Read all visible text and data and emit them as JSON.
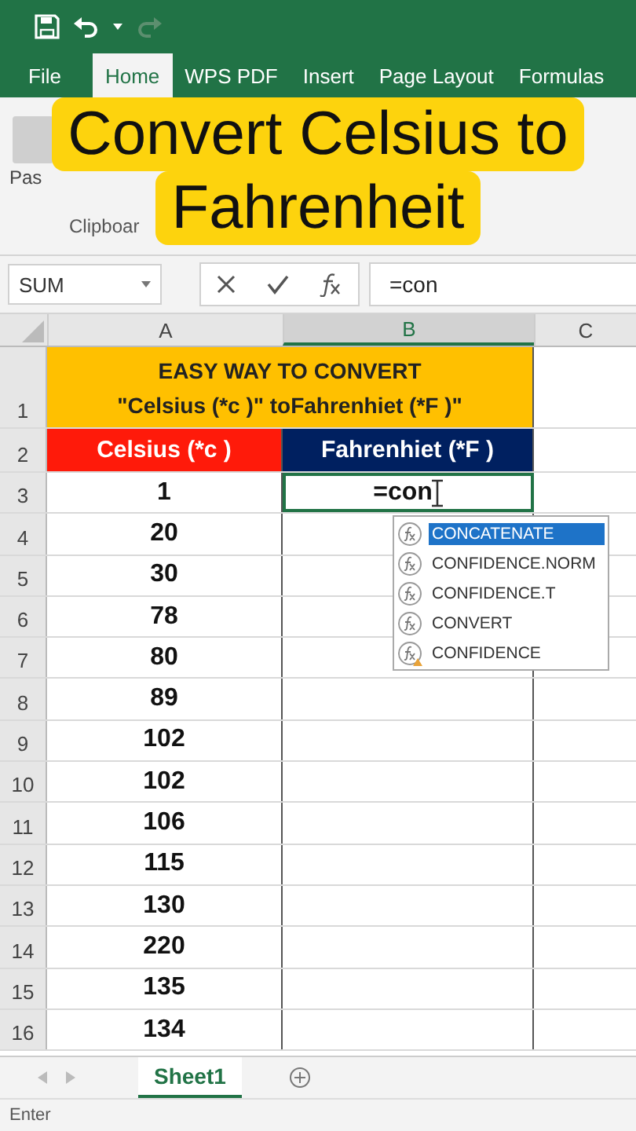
{
  "ribbon_tabs": [
    {
      "label": "File",
      "selected": false
    },
    {
      "label": "Home",
      "selected": true
    },
    {
      "label": "WPS PDF",
      "selected": false
    },
    {
      "label": "Insert",
      "selected": false
    },
    {
      "label": "Page Layout",
      "selected": false
    },
    {
      "label": "Formulas",
      "selected": false
    }
  ],
  "ribbon": {
    "paste_label": "Pas",
    "group_label": "Clipboar"
  },
  "caption": [
    "Convert Celsius to",
    "Fahrenheit"
  ],
  "formula_bar": {
    "name_box": "SUM",
    "formula": "=con"
  },
  "columns": [
    "A",
    "B",
    "C"
  ],
  "title_row": {
    "number": "1",
    "line_1": "EASY WAY TO CONVERT",
    "line_2": "\"Celsius (*c )\"  toFahrenhiet (*F )\""
  },
  "header_row": {
    "number": "2",
    "celsius": "Celsius (*c )",
    "fahrenheit": "Fahrenhiet (*F )"
  },
  "rows": [
    {
      "number": "3",
      "celsius": "1",
      "fahrenheit": "=con"
    },
    {
      "number": "4",
      "celsius": "20"
    },
    {
      "number": "5",
      "celsius": "30"
    },
    {
      "number": "6",
      "celsius": "78"
    },
    {
      "number": "7",
      "celsius": "80"
    },
    {
      "number": "8",
      "celsius": "89"
    },
    {
      "number": "9",
      "celsius": "102"
    },
    {
      "number": "10",
      "celsius": "102"
    },
    {
      "number": "11",
      "celsius": "106"
    },
    {
      "number": "12",
      "celsius": "115"
    },
    {
      "number": "13",
      "celsius": "130"
    },
    {
      "number": "14",
      "celsius": "220"
    },
    {
      "number": "15",
      "celsius": "135"
    },
    {
      "number": "16",
      "celsius": "134"
    }
  ],
  "autocomplete": [
    {
      "label": "CONCATENATE",
      "selected": true,
      "kind": "function"
    },
    {
      "label": "CONFIDENCE.NORM",
      "selected": false,
      "kind": "function"
    },
    {
      "label": "CONFIDENCE.T",
      "selected": false,
      "kind": "function"
    },
    {
      "label": "CONVERT",
      "selected": false,
      "kind": "function"
    },
    {
      "label": "CONFIDENCE",
      "selected": false,
      "kind": "compat"
    }
  ],
  "sheet_tabs": [
    {
      "label": "Sheet1",
      "selected": true
    }
  ],
  "status_bar": {
    "mode": "Enter"
  }
}
